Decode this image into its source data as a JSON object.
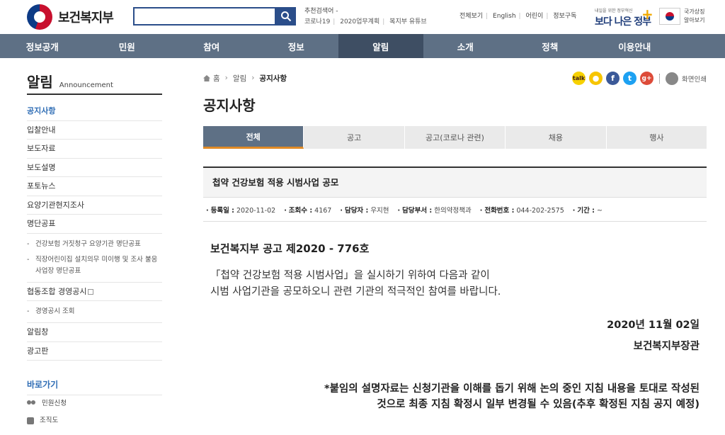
{
  "header": {
    "logo_text": "보건복지부",
    "search": {
      "value": "",
      "placeholder": ""
    },
    "recommend_title": "추천검색어 -",
    "recommend_links": [
      "코로나19",
      "2020업무계획",
      "복지부 유튜브"
    ],
    "util_links": [
      "전체보기",
      "English",
      "어린이",
      "정보구독"
    ],
    "better_gov_small": "내일을 위한 정부혁신",
    "better_gov_big": "보다 나은 정부",
    "national_symbol_label": [
      "국가상징",
      "알아보기"
    ]
  },
  "gnb": [
    "정보공개",
    "민원",
    "참여",
    "정보",
    "알림",
    "소개",
    "정책",
    "이용안내"
  ],
  "sidebar": {
    "title": "알림",
    "title_en": "Announcement",
    "items": [
      {
        "label": "공지사항",
        "active": true
      },
      {
        "label": "입찰안내"
      },
      {
        "label": "보도자료"
      },
      {
        "label": "보도설명"
      },
      {
        "label": "포토뉴스"
      },
      {
        "label": "요양기관현지조사"
      },
      {
        "label": "명단공표"
      }
    ],
    "subitems_1": [
      "건강보험 거짓청구 요양기관 명단공표",
      "직장어린이집 설치의무 미이행 및 조사 불응 사업장 명단공표"
    ],
    "item_coop": "협동조합 경영공시",
    "subitems_2": [
      "경영공시 조회"
    ],
    "item_alarm": "알림창",
    "item_ad": "광고판",
    "quick_title": "바로가기",
    "quick_items": [
      "민원신청",
      "조직도"
    ]
  },
  "breadcrumb": {
    "home": "홈",
    "level1": "알림",
    "current": "공지사항"
  },
  "share": {
    "print_label": "화면인쇄"
  },
  "page_title": "공지사항",
  "tabs": [
    "전체",
    "공고",
    "공고(코로나 관련)",
    "채용",
    "행사"
  ],
  "article": {
    "title": "첩약 건강보험 적용 시범사업 공모",
    "meta": {
      "reg_label": "등록일 :",
      "reg_value": "2020-11-02",
      "views_label": "조회수 :",
      "views_value": "4167",
      "manager_label": "담당자 :",
      "manager_value": "우지현",
      "dept_label": "담당부서 :",
      "dept_value": "한의약정책과",
      "phone_label": "전화번호 :",
      "phone_value": "044-202-2575",
      "period_label": "기간 :",
      "period_value": "~"
    },
    "notice_no": "보건복지부 공고 제2020 - 776호",
    "para_line1": "「첩약 건강보험 적용 시범사업」을 실시하기 위하여 다음과 같이",
    "para_line2": "시범 사업기관을 공모하오니 관련 기관의 적극적인 참여를 바랍니다.",
    "date": "2020년 11월 02일",
    "signer": "보건복지부장관",
    "footnote_line1": "*붙임의 설명자료는 신청기관을 이해를 돕기 위해 논의 중인 지침 내용을 토대로 작성된",
    "footnote_line2": "것으로 최종 지침 확정시 일부 변경될 수 있음(추후 확정된 지침 공지 예정)"
  }
}
